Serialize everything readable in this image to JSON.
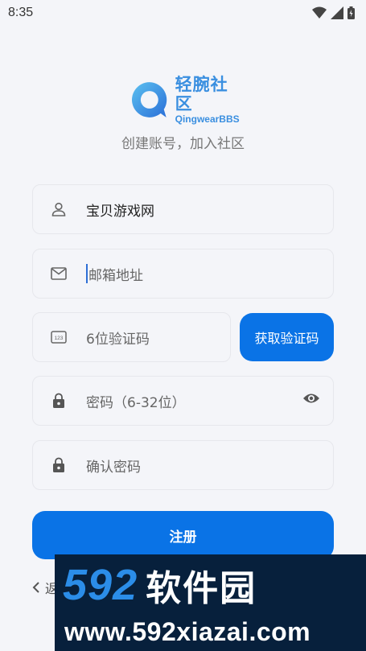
{
  "status_bar": {
    "time": "8:35"
  },
  "logo": {
    "name_cn": "轻腕社区",
    "name_en": "QingwearBBS"
  },
  "subtitle": "创建账号，加入社区",
  "form": {
    "username": {
      "value": "宝贝游戏网"
    },
    "email": {
      "placeholder": "邮箱地址"
    },
    "code": {
      "placeholder": "6位验证码",
      "button_label": "获取验证码"
    },
    "password": {
      "placeholder": "密码（6-32位）"
    },
    "confirm": {
      "placeholder": "确认密码"
    },
    "submit_label": "注册"
  },
  "back_link": {
    "label": "返"
  },
  "watermark": {
    "number": "592",
    "name_cn": "软件园",
    "url": "www.592xiazai.com"
  },
  "colors": {
    "accent": "#0a73e6",
    "background": "#f4f5f9",
    "logo": "#3a8fe0"
  }
}
